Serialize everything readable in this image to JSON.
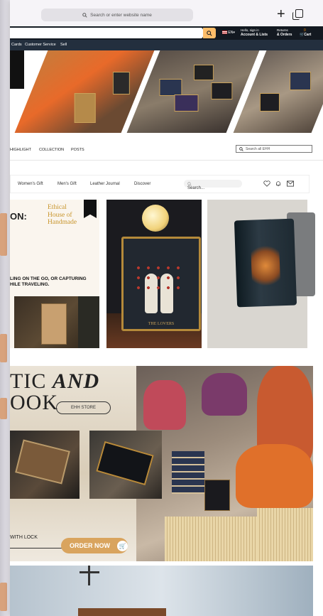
{
  "browser": {
    "address_placeholder": "Search or enter website name",
    "icons": [
      "search-icon",
      "plus-icon",
      "tabs-icon"
    ]
  },
  "amazon_header": {
    "language": "EN",
    "account_line1": "Hello, sign in",
    "account_line2": "Account & Lists",
    "orders_line1": "Returns",
    "orders_line2": "& Orders",
    "cart_label": "Cart",
    "cart_count": "0"
  },
  "subnav": {
    "items": [
      "Cards",
      "Customer Service",
      "Sell"
    ]
  },
  "store_nav": {
    "items": [
      "HIGHLIGHT",
      "COLLECTION",
      "POSTS"
    ],
    "search_placeholder": "Search all EHH"
  },
  "store_menu": {
    "items": [
      "Women's Gift",
      "Men's Gift",
      "Leather Journal",
      "Discover"
    ],
    "search_placeholder": "Search..."
  },
  "tile1": {
    "big_text": "ON:",
    "logo_lines": [
      "Ethical",
      "House of",
      "Handmade"
    ],
    "caption_lines": [
      "LING ON THE GO, OR CAPTURING",
      "HILE TRAVELING."
    ]
  },
  "tile2": {
    "card_label": "THE LOVERS"
  },
  "promo_banner": {
    "title_line1_a": "TIC ",
    "title_line1_b": "AND",
    "title_line2": "OOK",
    "store_button": "EHH STORE",
    "lock_text": "WITH LOCK",
    "order_button": "ORDER NOW"
  }
}
